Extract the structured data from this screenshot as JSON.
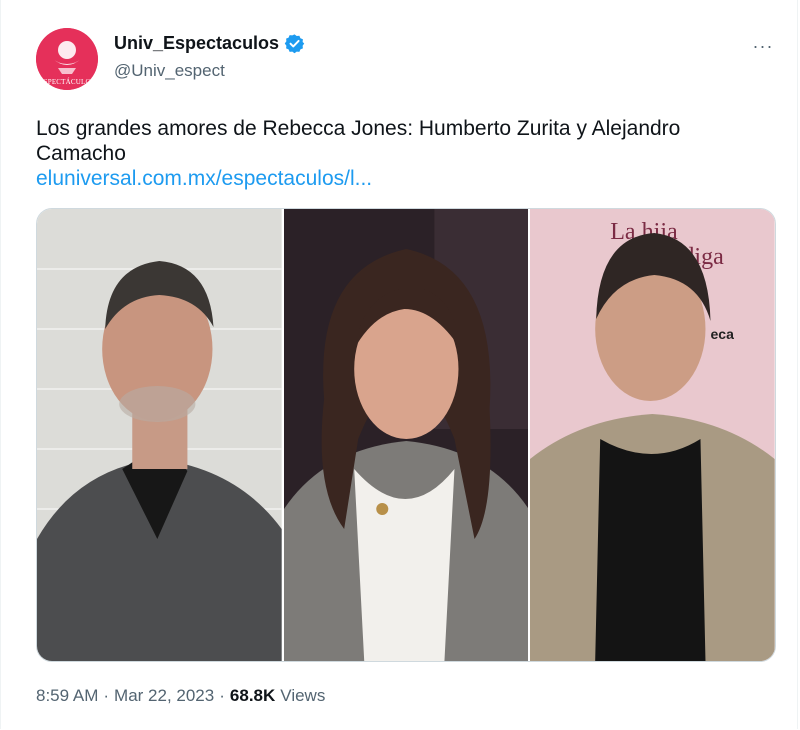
{
  "tweet": {
    "author": {
      "display_name": "Univ_Espectaculos",
      "handle": "@Univ_espect",
      "avatar_text": "ESPECTÁCULOS",
      "verified_icon": "verified-badge-icon"
    },
    "more_label": "···",
    "text": "Los grandes amores de Rebecca Jones: Humberto Zurita y Alejandro Camacho",
    "link": "eluniversal.com.mx/espectaculos/l...",
    "media": {
      "photos": [
        {
          "bg": "#d9d9d6"
        },
        {
          "bg": "#2a2228"
        },
        {
          "bg": "#e9c7cd",
          "sign_line1": "La hija",
          "sign_line2": "pródiga",
          "sign_side": "eca"
        }
      ]
    },
    "time": "8:59 AM",
    "separator": "·",
    "date": "Mar 22, 2023",
    "views_count": "68.8K",
    "views_label": "Views"
  },
  "colors": {
    "accent": "#1d9bf0",
    "text_secondary": "#536471",
    "avatar_bg": "#e5305a"
  }
}
